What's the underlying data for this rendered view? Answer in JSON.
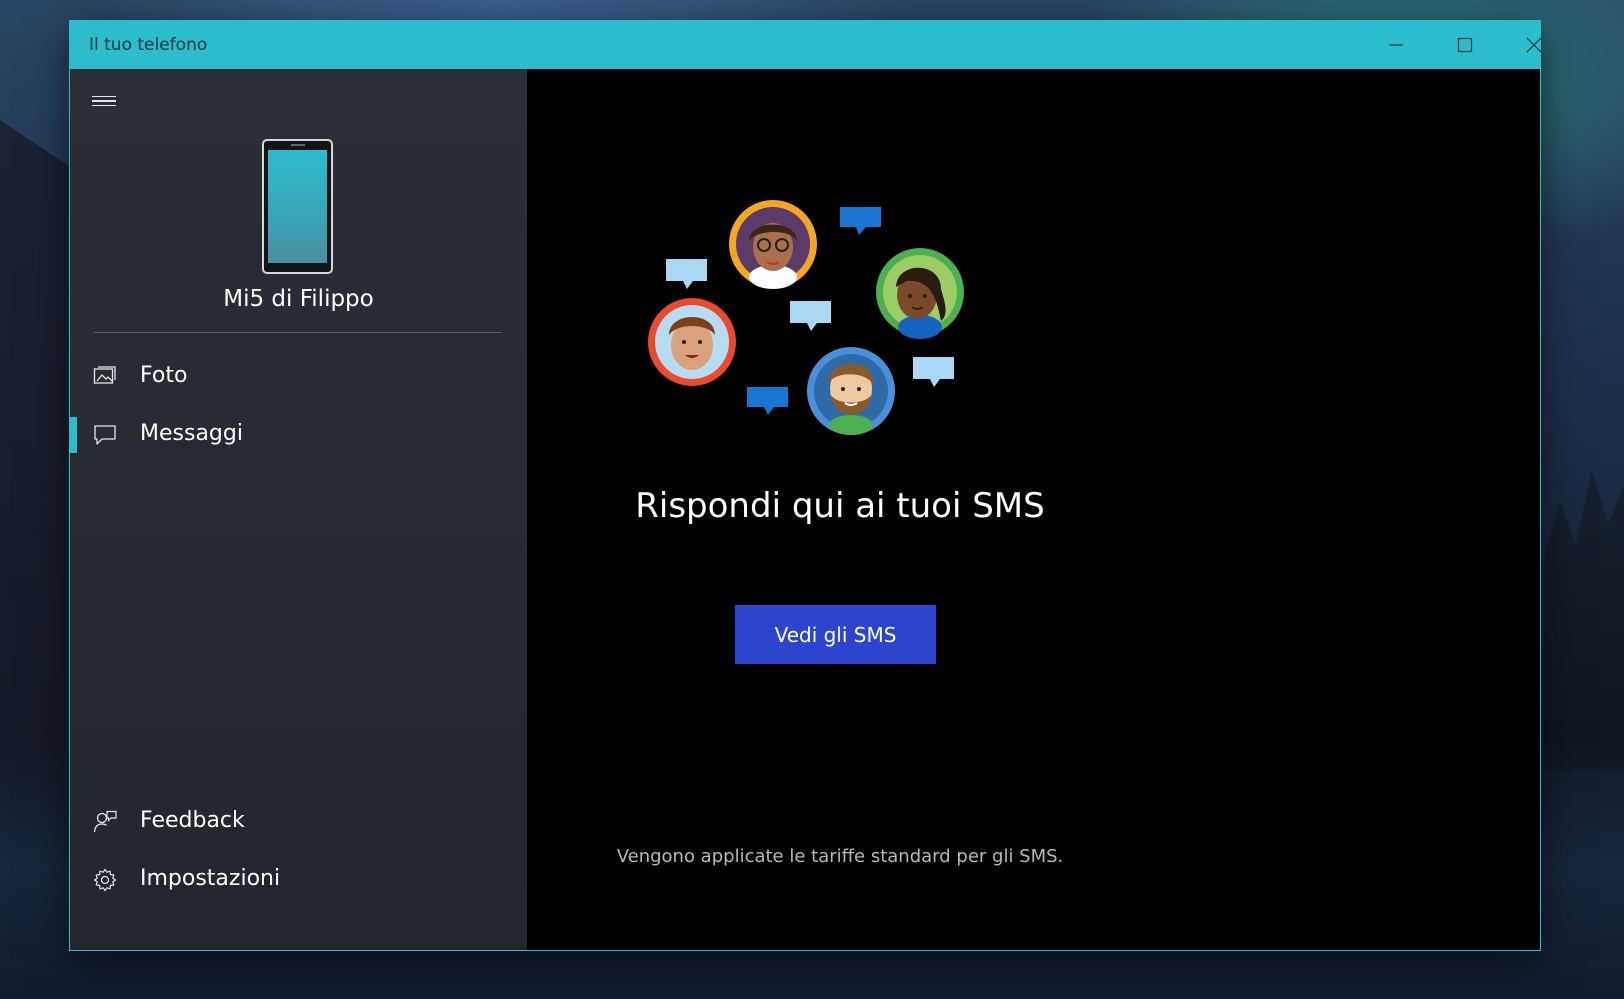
{
  "window": {
    "title": "Il tuo telefono",
    "controls": {
      "minimize": "minimize-icon",
      "maximize": "maximize-icon",
      "close": "close-icon"
    },
    "accent_color": "#2bbccd"
  },
  "sidebar": {
    "menu_icon": "hamburger-icon",
    "device": {
      "name": "Mi5 di Filippo",
      "icon": "phone-icon"
    },
    "nav": [
      {
        "label": "Foto",
        "icon": "photos-icon",
        "selected": false
      },
      {
        "label": "Messaggi",
        "icon": "message-icon",
        "selected": true
      }
    ],
    "footer": [
      {
        "label": "Feedback",
        "icon": "feedback-icon"
      },
      {
        "label": "Impostazioni",
        "icon": "gear-icon"
      }
    ]
  },
  "main": {
    "illustration": "people-chatting-illustration",
    "headline": "Rispondi qui ai tuoi SMS",
    "cta_label": "Vedi gli SMS",
    "cta_color": "#2c45cf",
    "footnote": "Vengono applicate le tariffe standard per gli SMS."
  }
}
